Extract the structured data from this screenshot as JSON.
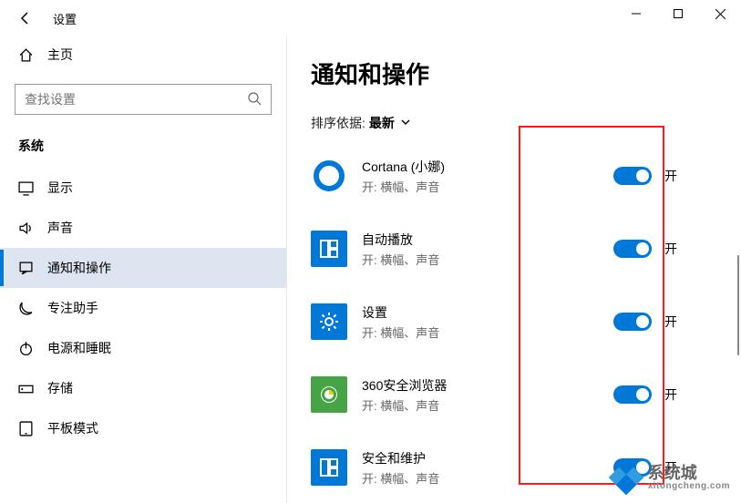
{
  "window": {
    "title": "设置",
    "minimize_tooltip": "最小化",
    "maximize_tooltip": "最大化",
    "close_tooltip": "关闭"
  },
  "sidebar": {
    "home_label": "主页",
    "search_placeholder": "查找设置",
    "section_label": "系统",
    "items": [
      {
        "label": "显示",
        "icon": "display-icon"
      },
      {
        "label": "声音",
        "icon": "sound-icon"
      },
      {
        "label": "通知和操作",
        "icon": "notifications-icon",
        "selected": true
      },
      {
        "label": "专注助手",
        "icon": "focus-assist-icon"
      },
      {
        "label": "电源和睡眠",
        "icon": "power-sleep-icon"
      },
      {
        "label": "存储",
        "icon": "storage-icon"
      },
      {
        "label": "平板模式",
        "icon": "tablet-mode-icon"
      }
    ]
  },
  "main": {
    "title": "通知和操作",
    "sort_label": "排序依据:",
    "sort_value": "最新",
    "apps": [
      {
        "name": "Cortana (小娜)",
        "sub": "开: 横幅、声音",
        "icon": "cortana-icon",
        "state_label": "开"
      },
      {
        "name": "自动播放",
        "sub": "开: 横幅、声音",
        "icon": "autoplay-icon",
        "state_label": "开"
      },
      {
        "name": "设置",
        "sub": "开: 横幅、声音",
        "icon": "settings-icon",
        "state_label": "开"
      },
      {
        "name": "360安全浏览器",
        "sub": "开: 横幅、声音",
        "icon": "360browser-icon",
        "state_label": "开"
      },
      {
        "name": "安全和维护",
        "sub": "开: 横幅、声音",
        "icon": "security-icon",
        "state_label": "开"
      }
    ]
  },
  "watermark": {
    "brand": "系统城",
    "url": "xitongcheng.com"
  }
}
